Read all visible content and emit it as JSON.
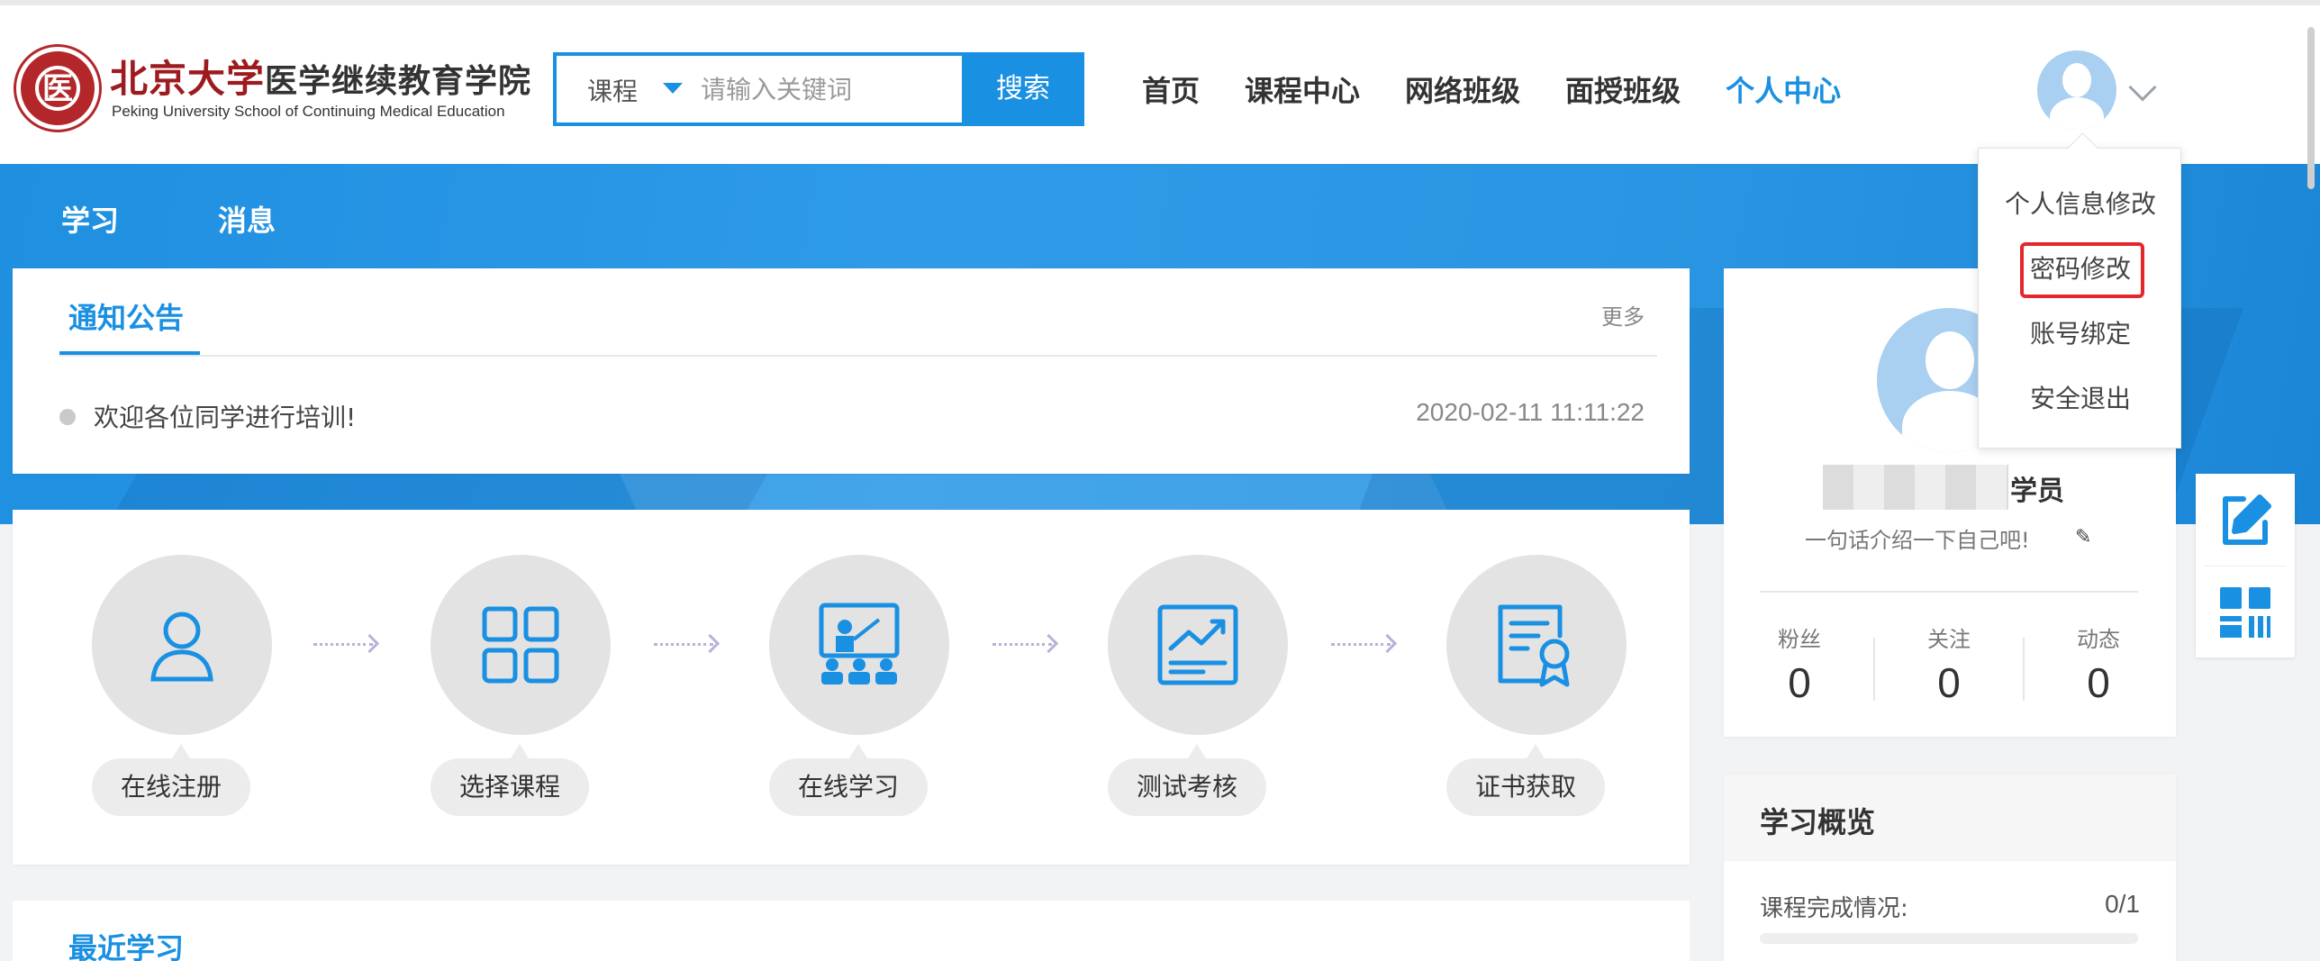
{
  "header": {
    "logo": {
      "name_cn": "北京大学",
      "name_cn_rest": "医学继续教育学院",
      "name_en": "Peking University School of Continuing Medical Education"
    },
    "search": {
      "type_label": "课程",
      "placeholder": "请输入关键词",
      "button_label": "搜索"
    },
    "nav": [
      {
        "label": "首页",
        "active": false
      },
      {
        "label": "课程中心",
        "active": false
      },
      {
        "label": "网络班级",
        "active": false
      },
      {
        "label": "面授班级",
        "active": false
      },
      {
        "label": "个人中心",
        "active": true
      }
    ]
  },
  "user_menu": {
    "items": [
      "个人信息修改",
      "密码修改",
      "账号绑定",
      "安全退出"
    ],
    "highlighted": "密码修改"
  },
  "banner": {
    "tabs": [
      "学习",
      "消息"
    ]
  },
  "notice": {
    "title": "通知公告",
    "more": "更多",
    "items": [
      {
        "text": "欢迎各位同学进行培训!",
        "time": "2020-02-11 11:11:22"
      }
    ]
  },
  "steps": [
    {
      "label": "在线注册",
      "icon": "user-icon"
    },
    {
      "label": "选择课程",
      "icon": "grid-icon"
    },
    {
      "label": "在线学习",
      "icon": "classroom-icon"
    },
    {
      "label": "测试考核",
      "icon": "chart-board-icon"
    },
    {
      "label": "证书获取",
      "icon": "certificate-icon"
    }
  ],
  "recent": {
    "title": "最近学习"
  },
  "profile": {
    "role": "学员",
    "intro": "一句话介绍一下自己吧!",
    "stats": [
      {
        "label": "粉丝",
        "value": "0"
      },
      {
        "label": "关注",
        "value": "0"
      },
      {
        "label": "动态",
        "value": "0"
      }
    ]
  },
  "overview": {
    "title": "学习概览",
    "course_label": "课程完成情况:",
    "course_value": "0/1"
  },
  "side_tools": [
    "edit-icon",
    "qrcode-icon"
  ],
  "colors": {
    "primary": "#1a90e2",
    "highlight_border": "#e3272d",
    "logo_red": "#9d1b1f"
  }
}
